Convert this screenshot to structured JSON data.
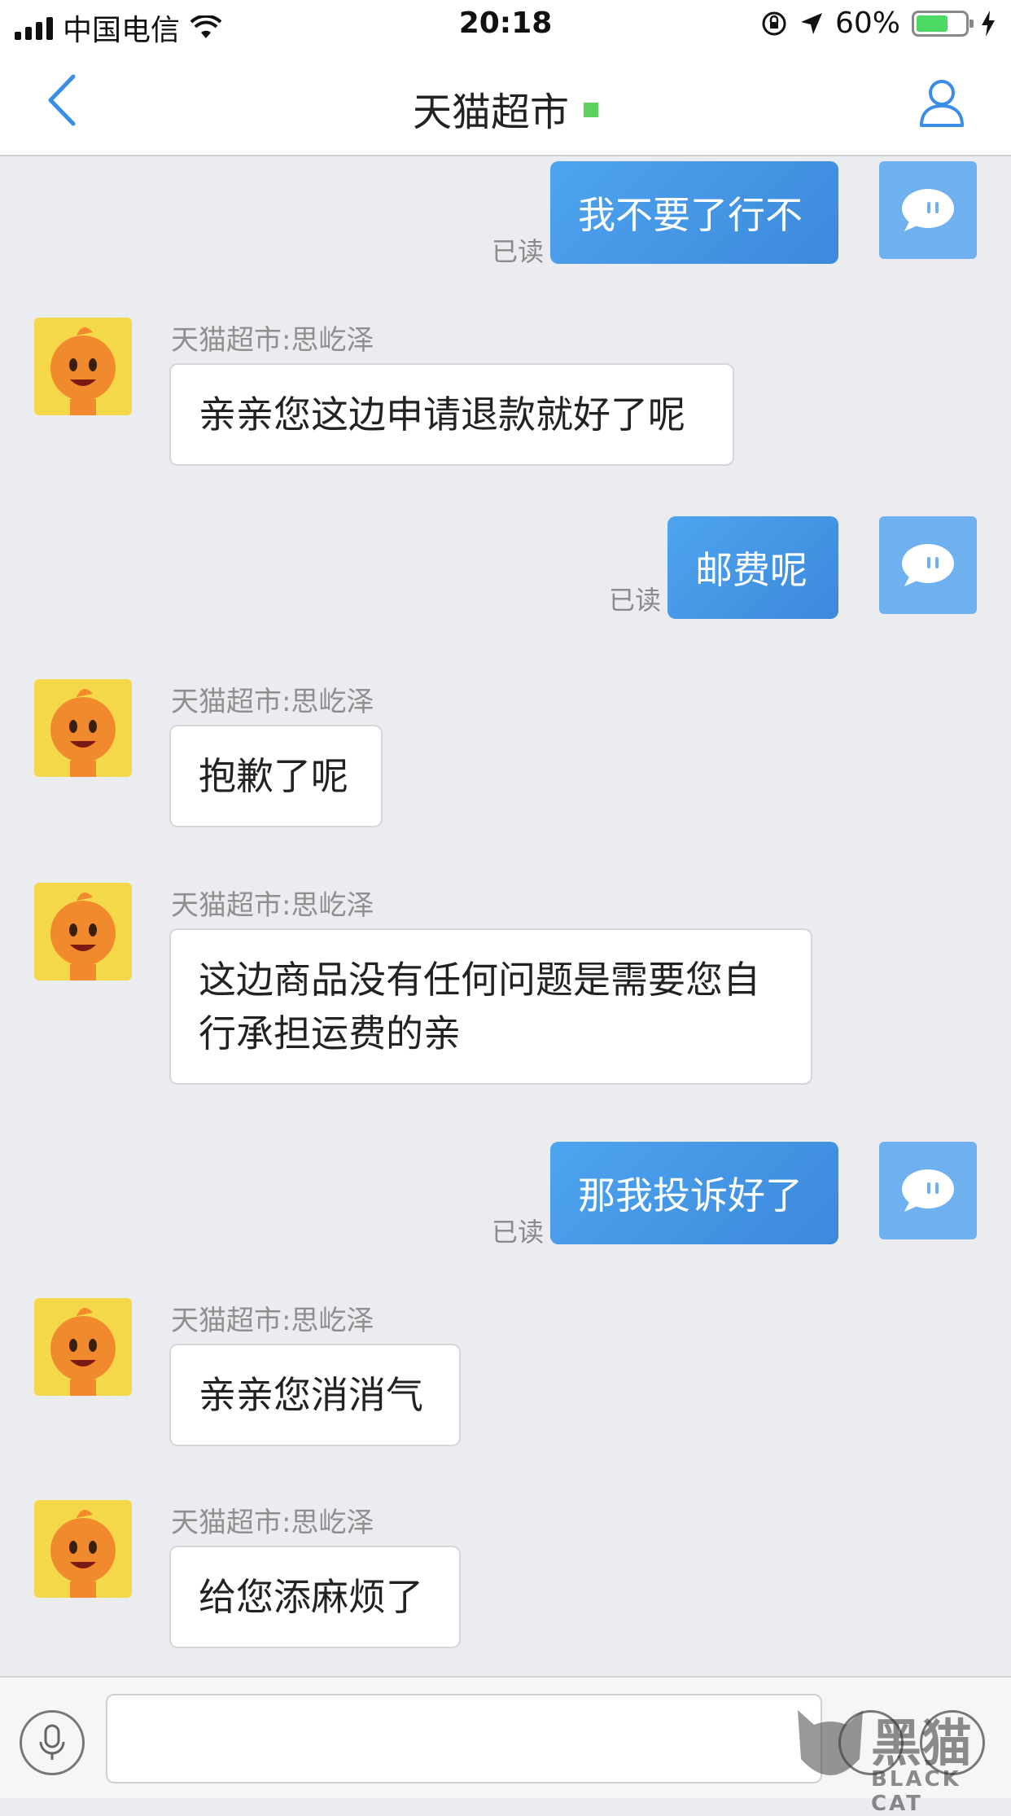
{
  "status_bar": {
    "carrier": "中国电信",
    "time": "20:18",
    "battery_percent": "60%",
    "battery_level": 0.6,
    "icons": [
      "signal-icon",
      "wifi-icon",
      "rotation-lock-icon",
      "location-icon",
      "battery-icon",
      "charging-icon"
    ]
  },
  "nav": {
    "title": "天猫超市",
    "online_color": "#5cd35c",
    "back_icon": "chevron-left-icon",
    "profile_icon": "person-icon"
  },
  "messages": [
    {
      "side": "me",
      "text": "我不要了行不",
      "read": "已读"
    },
    {
      "side": "cs",
      "sender": "天猫超市:思屹泽",
      "text": "亲亲您这边申请退款就好了呢"
    },
    {
      "side": "me",
      "text": "邮费呢",
      "read": "已读"
    },
    {
      "side": "cs",
      "sender": "天猫超市:思屹泽",
      "text": "抱歉了呢"
    },
    {
      "side": "cs",
      "sender": "天猫超市:思屹泽",
      "text_lines": [
        "这边商品没有任何问题是需要您自",
        "行承担运费的亲"
      ]
    },
    {
      "side": "me",
      "text": "那我投诉好了",
      "read": "已读"
    },
    {
      "side": "cs",
      "sender": "天猫超市:思屹泽",
      "text": "亲亲您消消气"
    },
    {
      "side": "cs",
      "sender": "天猫超市:思屹泽",
      "text": "给您添麻烦了"
    }
  ],
  "input": {
    "value": "",
    "mic_icon": "microphone-icon"
  },
  "watermark": {
    "text_cn": "黑猫",
    "text_en": "BLACK CAT"
  },
  "colors": {
    "accent": "#3d89dc",
    "background": "#ebecf0",
    "cs_avatar_bg": "#f5d84a",
    "me_avatar_bg": "#6fb0ef"
  }
}
